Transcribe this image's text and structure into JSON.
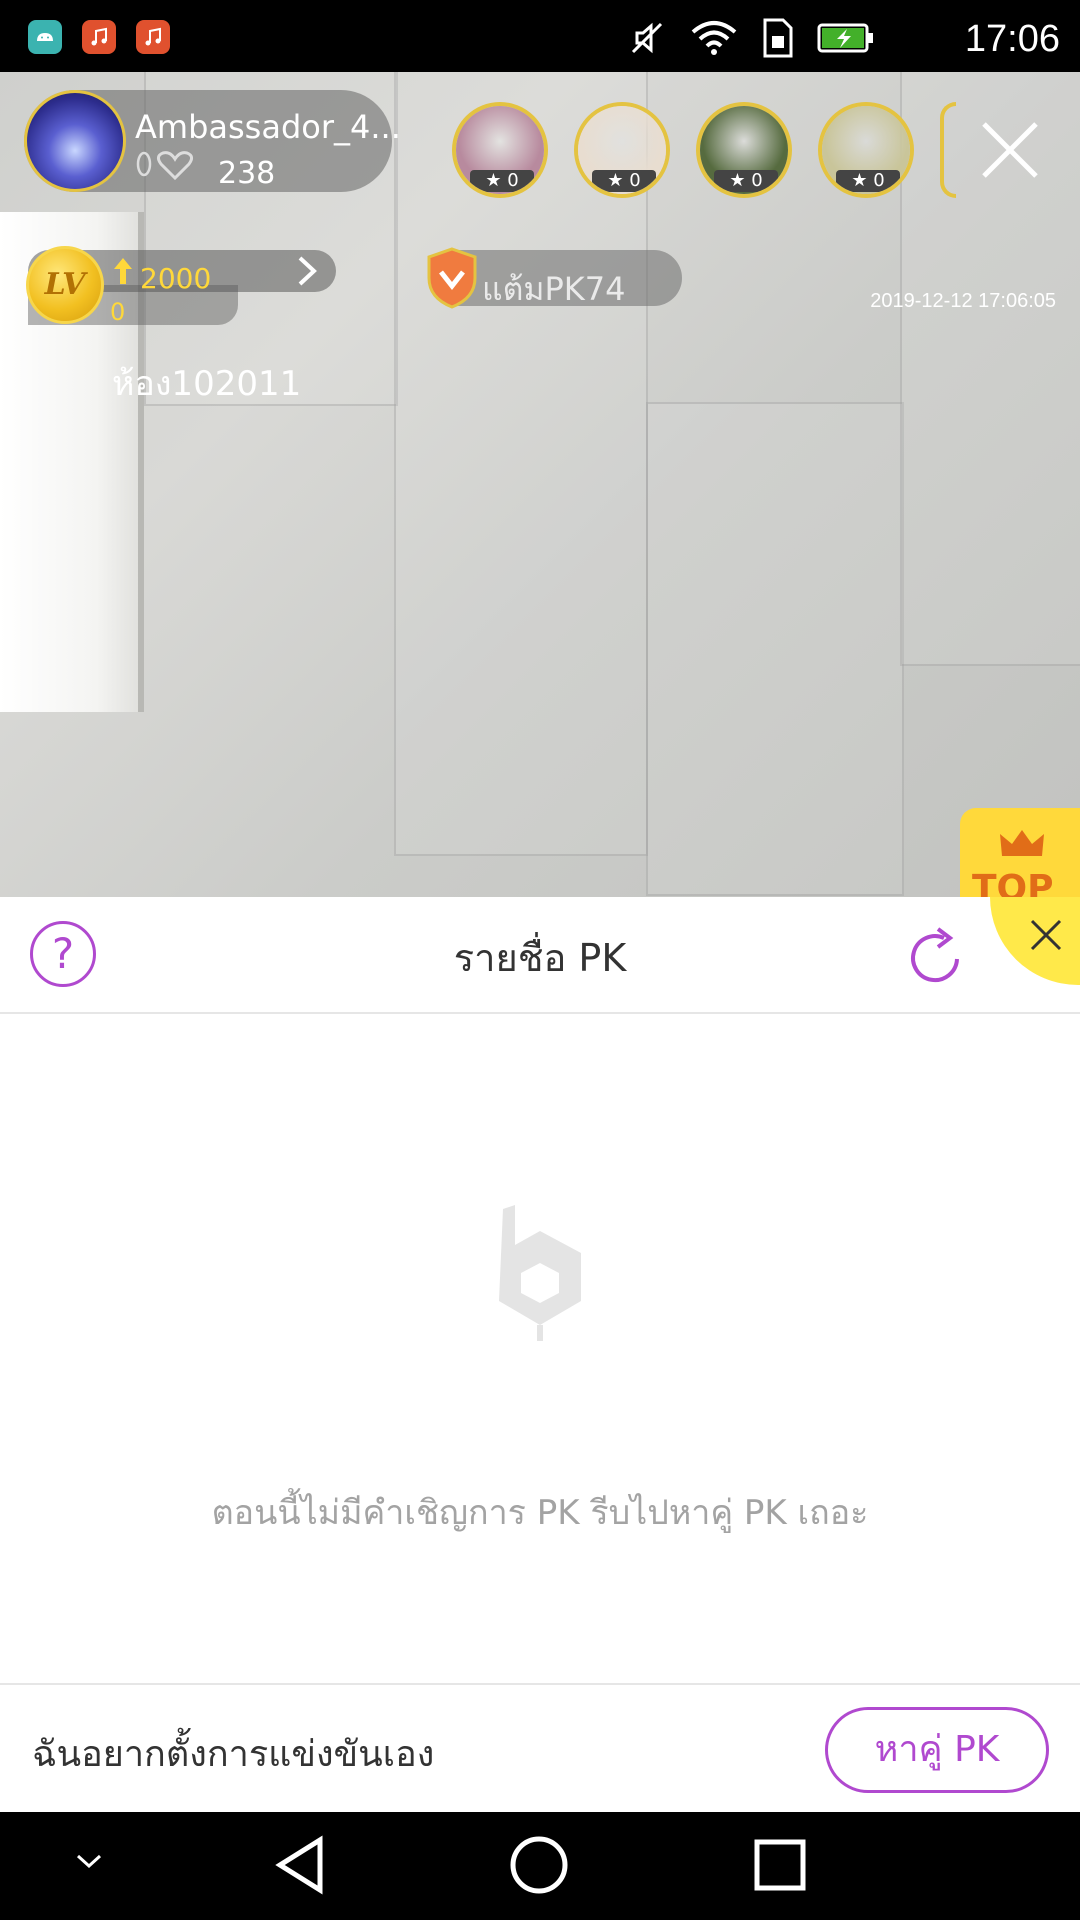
{
  "status_bar": {
    "time": "17:06",
    "apps": [
      "android-icon",
      "music-icon",
      "music-icon"
    ],
    "icons": [
      "mute-icon",
      "wifi-icon",
      "sim-icon",
      "battery-charging-icon"
    ]
  },
  "host": {
    "name": "Ambassador_4...",
    "count": "238"
  },
  "viewers": [
    {
      "badge": "0",
      "color": "#b88a9e"
    },
    {
      "badge": "0",
      "color": "#e8ddd0"
    },
    {
      "badge": "0",
      "color": "#566b3f"
    },
    {
      "badge": "0",
      "color": "#c9c59a"
    }
  ],
  "level": {
    "badge": "LV",
    "value": "2000",
    "sub": "0"
  },
  "pk_points": "แต้มPK74",
  "timestamp": "2019-12-12 17:06:05",
  "room_id": "ห้อง102011",
  "top_badge": "TOP",
  "sheet": {
    "title": "รายชื่อ PK",
    "empty_message": "ตอนนี้ไม่มีคำเชิญการ PK รีบไปหาคู่ PK เถอะ",
    "footer_text": "ฉันอยากตั้งการแข่งขันเอง",
    "find_button": "หาคู่ PK"
  },
  "colors": {
    "accent": "#b049cf",
    "gold": "#e4c341",
    "yellow": "#ffe94a"
  }
}
